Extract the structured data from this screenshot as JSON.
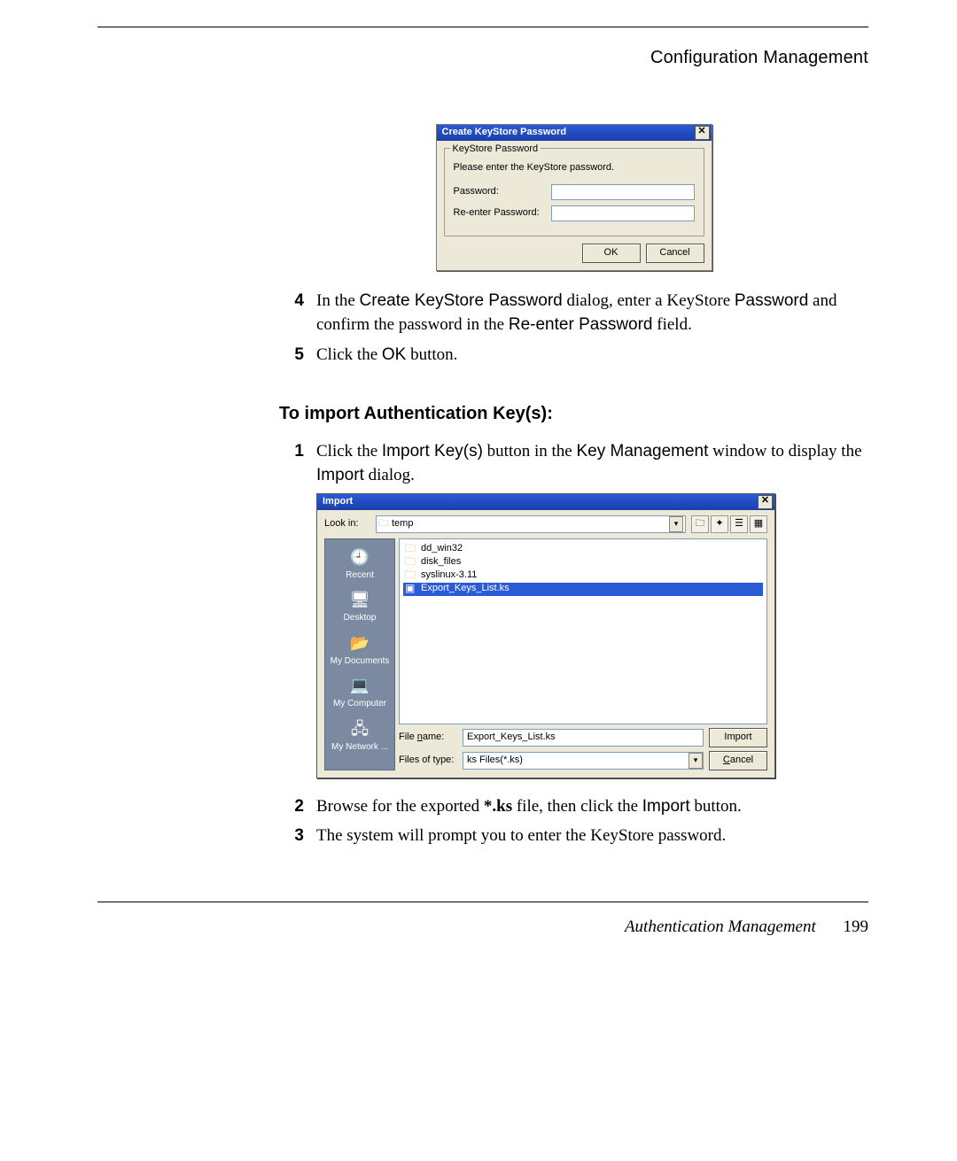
{
  "running_head": "Configuration Management",
  "footer_title": "Authentication Management",
  "page_number": "199",
  "dlg1": {
    "title": "Create KeyStore Password",
    "group_title": "KeyStore Password",
    "prompt": "Please enter the KeyStore password.",
    "pw_label": "Password:",
    "repw_label": "Re-enter Password:",
    "ok": "OK",
    "cancel": "Cancel"
  },
  "steps_a": {
    "n4": "4",
    "t4_pre": "In the ",
    "t4_b1": "Create KeyStore Password",
    "t4_mid1": " dialog, enter a KeyStore ",
    "t4_b2": "Password",
    "t4_mid2": " and confirm the password in the ",
    "t4_b3": "Re-enter Password",
    "t4_end": " field.",
    "n5": "5",
    "t5_pre": "Click the ",
    "t5_b1": "OK",
    "t5_end": " button."
  },
  "heading": "To import Authentication Key(s):",
  "steps_b": {
    "n1": "1",
    "t1_pre": "Click the ",
    "t1_b1": "Import Key(s)",
    "t1_mid1": " button in the ",
    "t1_b2": "Key Management",
    "t1_mid2": " window to display the ",
    "t1_b3": "Import",
    "t1_end": " dialog.",
    "n2": "2",
    "t2_pre": "Browse for the exported ",
    "t2_bold": "*.ks",
    "t2_mid": " file, then click the ",
    "t2_b1": "Import",
    "t2_end": " button.",
    "n3": "3",
    "t3": "The system will prompt you to enter the KeyStore password."
  },
  "dlg2": {
    "title": "Import",
    "lookin_label": "Look in:",
    "lookin_value": "temp",
    "side": [
      "Recent",
      "Desktop",
      "My Documents",
      "My Computer",
      "My Network ..."
    ],
    "files": [
      {
        "name": "dd_win32",
        "type": "folder"
      },
      {
        "name": "disk_files",
        "type": "folder"
      },
      {
        "name": "syslinux-3.11",
        "type": "folder"
      },
      {
        "name": "Export_Keys_List.ks",
        "type": "file",
        "selected": true
      }
    ],
    "filename_label": "File name:",
    "filename_value": "Export_Keys_List.ks",
    "filetype_label": "Files of type:",
    "filetype_value": "ks Files(*.ks)",
    "import_btn": "Import",
    "cancel_btn": "Cancel"
  }
}
